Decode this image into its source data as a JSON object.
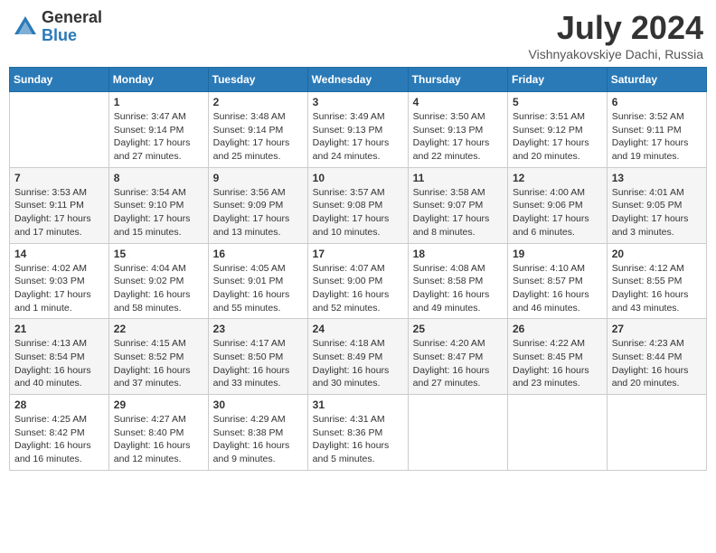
{
  "header": {
    "logo_general": "General",
    "logo_blue": "Blue",
    "month_title": "July 2024",
    "location": "Vishnyakovskiye Dachi, Russia"
  },
  "weekdays": [
    "Sunday",
    "Monday",
    "Tuesday",
    "Wednesday",
    "Thursday",
    "Friday",
    "Saturday"
  ],
  "weeks": [
    [
      {
        "day": "",
        "info": ""
      },
      {
        "day": "1",
        "info": "Sunrise: 3:47 AM\nSunset: 9:14 PM\nDaylight: 17 hours\nand 27 minutes."
      },
      {
        "day": "2",
        "info": "Sunrise: 3:48 AM\nSunset: 9:14 PM\nDaylight: 17 hours\nand 25 minutes."
      },
      {
        "day": "3",
        "info": "Sunrise: 3:49 AM\nSunset: 9:13 PM\nDaylight: 17 hours\nand 24 minutes."
      },
      {
        "day": "4",
        "info": "Sunrise: 3:50 AM\nSunset: 9:13 PM\nDaylight: 17 hours\nand 22 minutes."
      },
      {
        "day": "5",
        "info": "Sunrise: 3:51 AM\nSunset: 9:12 PM\nDaylight: 17 hours\nand 20 minutes."
      },
      {
        "day": "6",
        "info": "Sunrise: 3:52 AM\nSunset: 9:11 PM\nDaylight: 17 hours\nand 19 minutes."
      }
    ],
    [
      {
        "day": "7",
        "info": "Sunrise: 3:53 AM\nSunset: 9:11 PM\nDaylight: 17 hours\nand 17 minutes."
      },
      {
        "day": "8",
        "info": "Sunrise: 3:54 AM\nSunset: 9:10 PM\nDaylight: 17 hours\nand 15 minutes."
      },
      {
        "day": "9",
        "info": "Sunrise: 3:56 AM\nSunset: 9:09 PM\nDaylight: 17 hours\nand 13 minutes."
      },
      {
        "day": "10",
        "info": "Sunrise: 3:57 AM\nSunset: 9:08 PM\nDaylight: 17 hours\nand 10 minutes."
      },
      {
        "day": "11",
        "info": "Sunrise: 3:58 AM\nSunset: 9:07 PM\nDaylight: 17 hours\nand 8 minutes."
      },
      {
        "day": "12",
        "info": "Sunrise: 4:00 AM\nSunset: 9:06 PM\nDaylight: 17 hours\nand 6 minutes."
      },
      {
        "day": "13",
        "info": "Sunrise: 4:01 AM\nSunset: 9:05 PM\nDaylight: 17 hours\nand 3 minutes."
      }
    ],
    [
      {
        "day": "14",
        "info": "Sunrise: 4:02 AM\nSunset: 9:03 PM\nDaylight: 17 hours\nand 1 minute."
      },
      {
        "day": "15",
        "info": "Sunrise: 4:04 AM\nSunset: 9:02 PM\nDaylight: 16 hours\nand 58 minutes."
      },
      {
        "day": "16",
        "info": "Sunrise: 4:05 AM\nSunset: 9:01 PM\nDaylight: 16 hours\nand 55 minutes."
      },
      {
        "day": "17",
        "info": "Sunrise: 4:07 AM\nSunset: 9:00 PM\nDaylight: 16 hours\nand 52 minutes."
      },
      {
        "day": "18",
        "info": "Sunrise: 4:08 AM\nSunset: 8:58 PM\nDaylight: 16 hours\nand 49 minutes."
      },
      {
        "day": "19",
        "info": "Sunrise: 4:10 AM\nSunset: 8:57 PM\nDaylight: 16 hours\nand 46 minutes."
      },
      {
        "day": "20",
        "info": "Sunrise: 4:12 AM\nSunset: 8:55 PM\nDaylight: 16 hours\nand 43 minutes."
      }
    ],
    [
      {
        "day": "21",
        "info": "Sunrise: 4:13 AM\nSunset: 8:54 PM\nDaylight: 16 hours\nand 40 minutes."
      },
      {
        "day": "22",
        "info": "Sunrise: 4:15 AM\nSunset: 8:52 PM\nDaylight: 16 hours\nand 37 minutes."
      },
      {
        "day": "23",
        "info": "Sunrise: 4:17 AM\nSunset: 8:50 PM\nDaylight: 16 hours\nand 33 minutes."
      },
      {
        "day": "24",
        "info": "Sunrise: 4:18 AM\nSunset: 8:49 PM\nDaylight: 16 hours\nand 30 minutes."
      },
      {
        "day": "25",
        "info": "Sunrise: 4:20 AM\nSunset: 8:47 PM\nDaylight: 16 hours\nand 27 minutes."
      },
      {
        "day": "26",
        "info": "Sunrise: 4:22 AM\nSunset: 8:45 PM\nDaylight: 16 hours\nand 23 minutes."
      },
      {
        "day": "27",
        "info": "Sunrise: 4:23 AM\nSunset: 8:44 PM\nDaylight: 16 hours\nand 20 minutes."
      }
    ],
    [
      {
        "day": "28",
        "info": "Sunrise: 4:25 AM\nSunset: 8:42 PM\nDaylight: 16 hours\nand 16 minutes."
      },
      {
        "day": "29",
        "info": "Sunrise: 4:27 AM\nSunset: 8:40 PM\nDaylight: 16 hours\nand 12 minutes."
      },
      {
        "day": "30",
        "info": "Sunrise: 4:29 AM\nSunset: 8:38 PM\nDaylight: 16 hours\nand 9 minutes."
      },
      {
        "day": "31",
        "info": "Sunrise: 4:31 AM\nSunset: 8:36 PM\nDaylight: 16 hours\nand 5 minutes."
      },
      {
        "day": "",
        "info": ""
      },
      {
        "day": "",
        "info": ""
      },
      {
        "day": "",
        "info": ""
      }
    ]
  ]
}
